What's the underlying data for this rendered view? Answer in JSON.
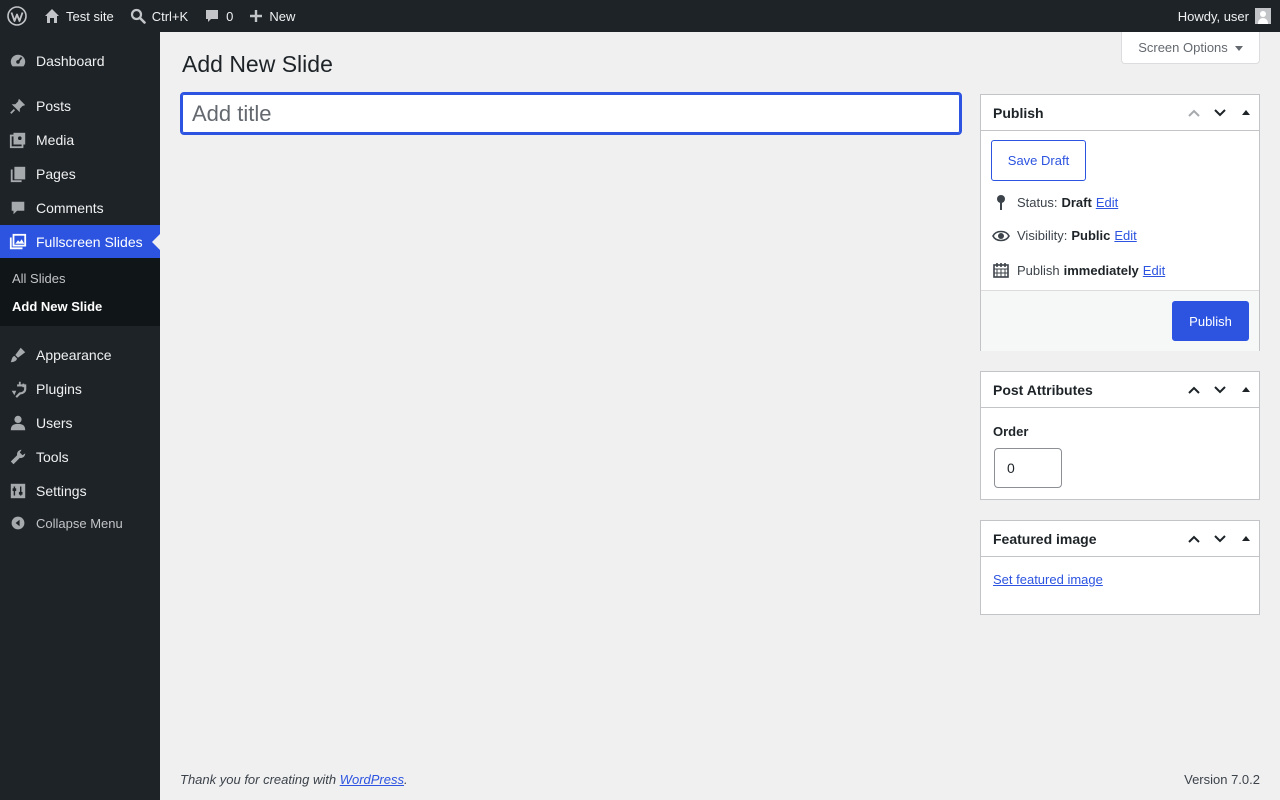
{
  "admin_bar": {
    "site_name": "Test site",
    "shortcut": "Ctrl+K",
    "comments_count": "0",
    "new_label": "New",
    "greeting": "Howdy, user"
  },
  "sidebar": {
    "items": [
      {
        "label": "Dashboard",
        "icon": "dashboard-icon"
      },
      {
        "label": "Posts",
        "icon": "pin-icon"
      },
      {
        "label": "Media",
        "icon": "media-icon"
      },
      {
        "label": "Pages",
        "icon": "pages-icon"
      },
      {
        "label": "Comments",
        "icon": "comment-icon"
      },
      {
        "label": "Fullscreen Slides",
        "icon": "slides-icon"
      },
      {
        "label": "Appearance",
        "icon": "brush-icon"
      },
      {
        "label": "Plugins",
        "icon": "plug-icon"
      },
      {
        "label": "Users",
        "icon": "user-icon"
      },
      {
        "label": "Tools",
        "icon": "wrench-icon"
      },
      {
        "label": "Settings",
        "icon": "settings-icon"
      }
    ],
    "submenu": [
      "All Slides",
      "Add New Slide"
    ],
    "collapse_label": "Collapse Menu",
    "accent_color": "#2c54e0"
  },
  "screen_options": "Screen Options",
  "page_title": "Add New Slide",
  "title_input": {
    "placeholder": "Add title",
    "value": ""
  },
  "publish_box": {
    "title": "Publish",
    "save_draft": "Save Draft",
    "status_label": "Status:",
    "status_value": "Draft",
    "visibility_label": "Visibility:",
    "visibility_value": "Public",
    "publish_label": "Publish",
    "publish_value": "immediately",
    "edit_link": "Edit",
    "publish_button": "Publish"
  },
  "attributes_box": {
    "title": "Post Attributes",
    "order_label": "Order",
    "order_value": "0"
  },
  "featured_box": {
    "title": "Featured image",
    "link": "Set featured image"
  },
  "footer": {
    "thanks_prefix": "Thank you for creating with",
    "thanks_link": "WordPress",
    "thanks_suffix": ".",
    "version": "Version 7.0.2"
  }
}
